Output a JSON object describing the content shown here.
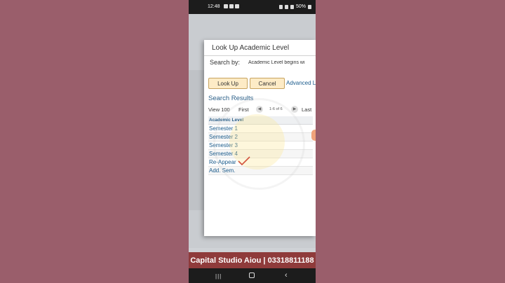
{
  "status_bar": {
    "time": "12:48",
    "battery": "50%"
  },
  "dialog": {
    "title": "Look Up Academic Level",
    "search_by_label": "Search by:",
    "search_by_value": "Academic Level begins wi",
    "lookup_button": "Look Up",
    "cancel_button": "Cancel",
    "advanced_link": "Advanced L",
    "results_title": "Search Results",
    "pager": {
      "view": "View 100",
      "first": "First",
      "count": "1-6 of 6",
      "last": "Last"
    },
    "column_header": "Academic Level",
    "rows": [
      "Semester 1",
      "Semester 2",
      "Semester 3",
      "Semester 4",
      "Re-Appear",
      "Add. Sem."
    ]
  },
  "banner": {
    "text": "Capital Studio Aiou | 03318811188"
  },
  "colors": {
    "background": "#9a5e6b",
    "banner": "#8f3b3b",
    "link": "#1b5b8c",
    "button_fill": "#fdebc6",
    "checkmark": "#c0141b"
  },
  "icons": [
    "wifi-icon",
    "signal-icon",
    "battery-icon",
    "prev-page-icon",
    "next-page-icon",
    "checkmark-icon",
    "recent-apps-icon",
    "home-icon",
    "back-icon"
  ]
}
